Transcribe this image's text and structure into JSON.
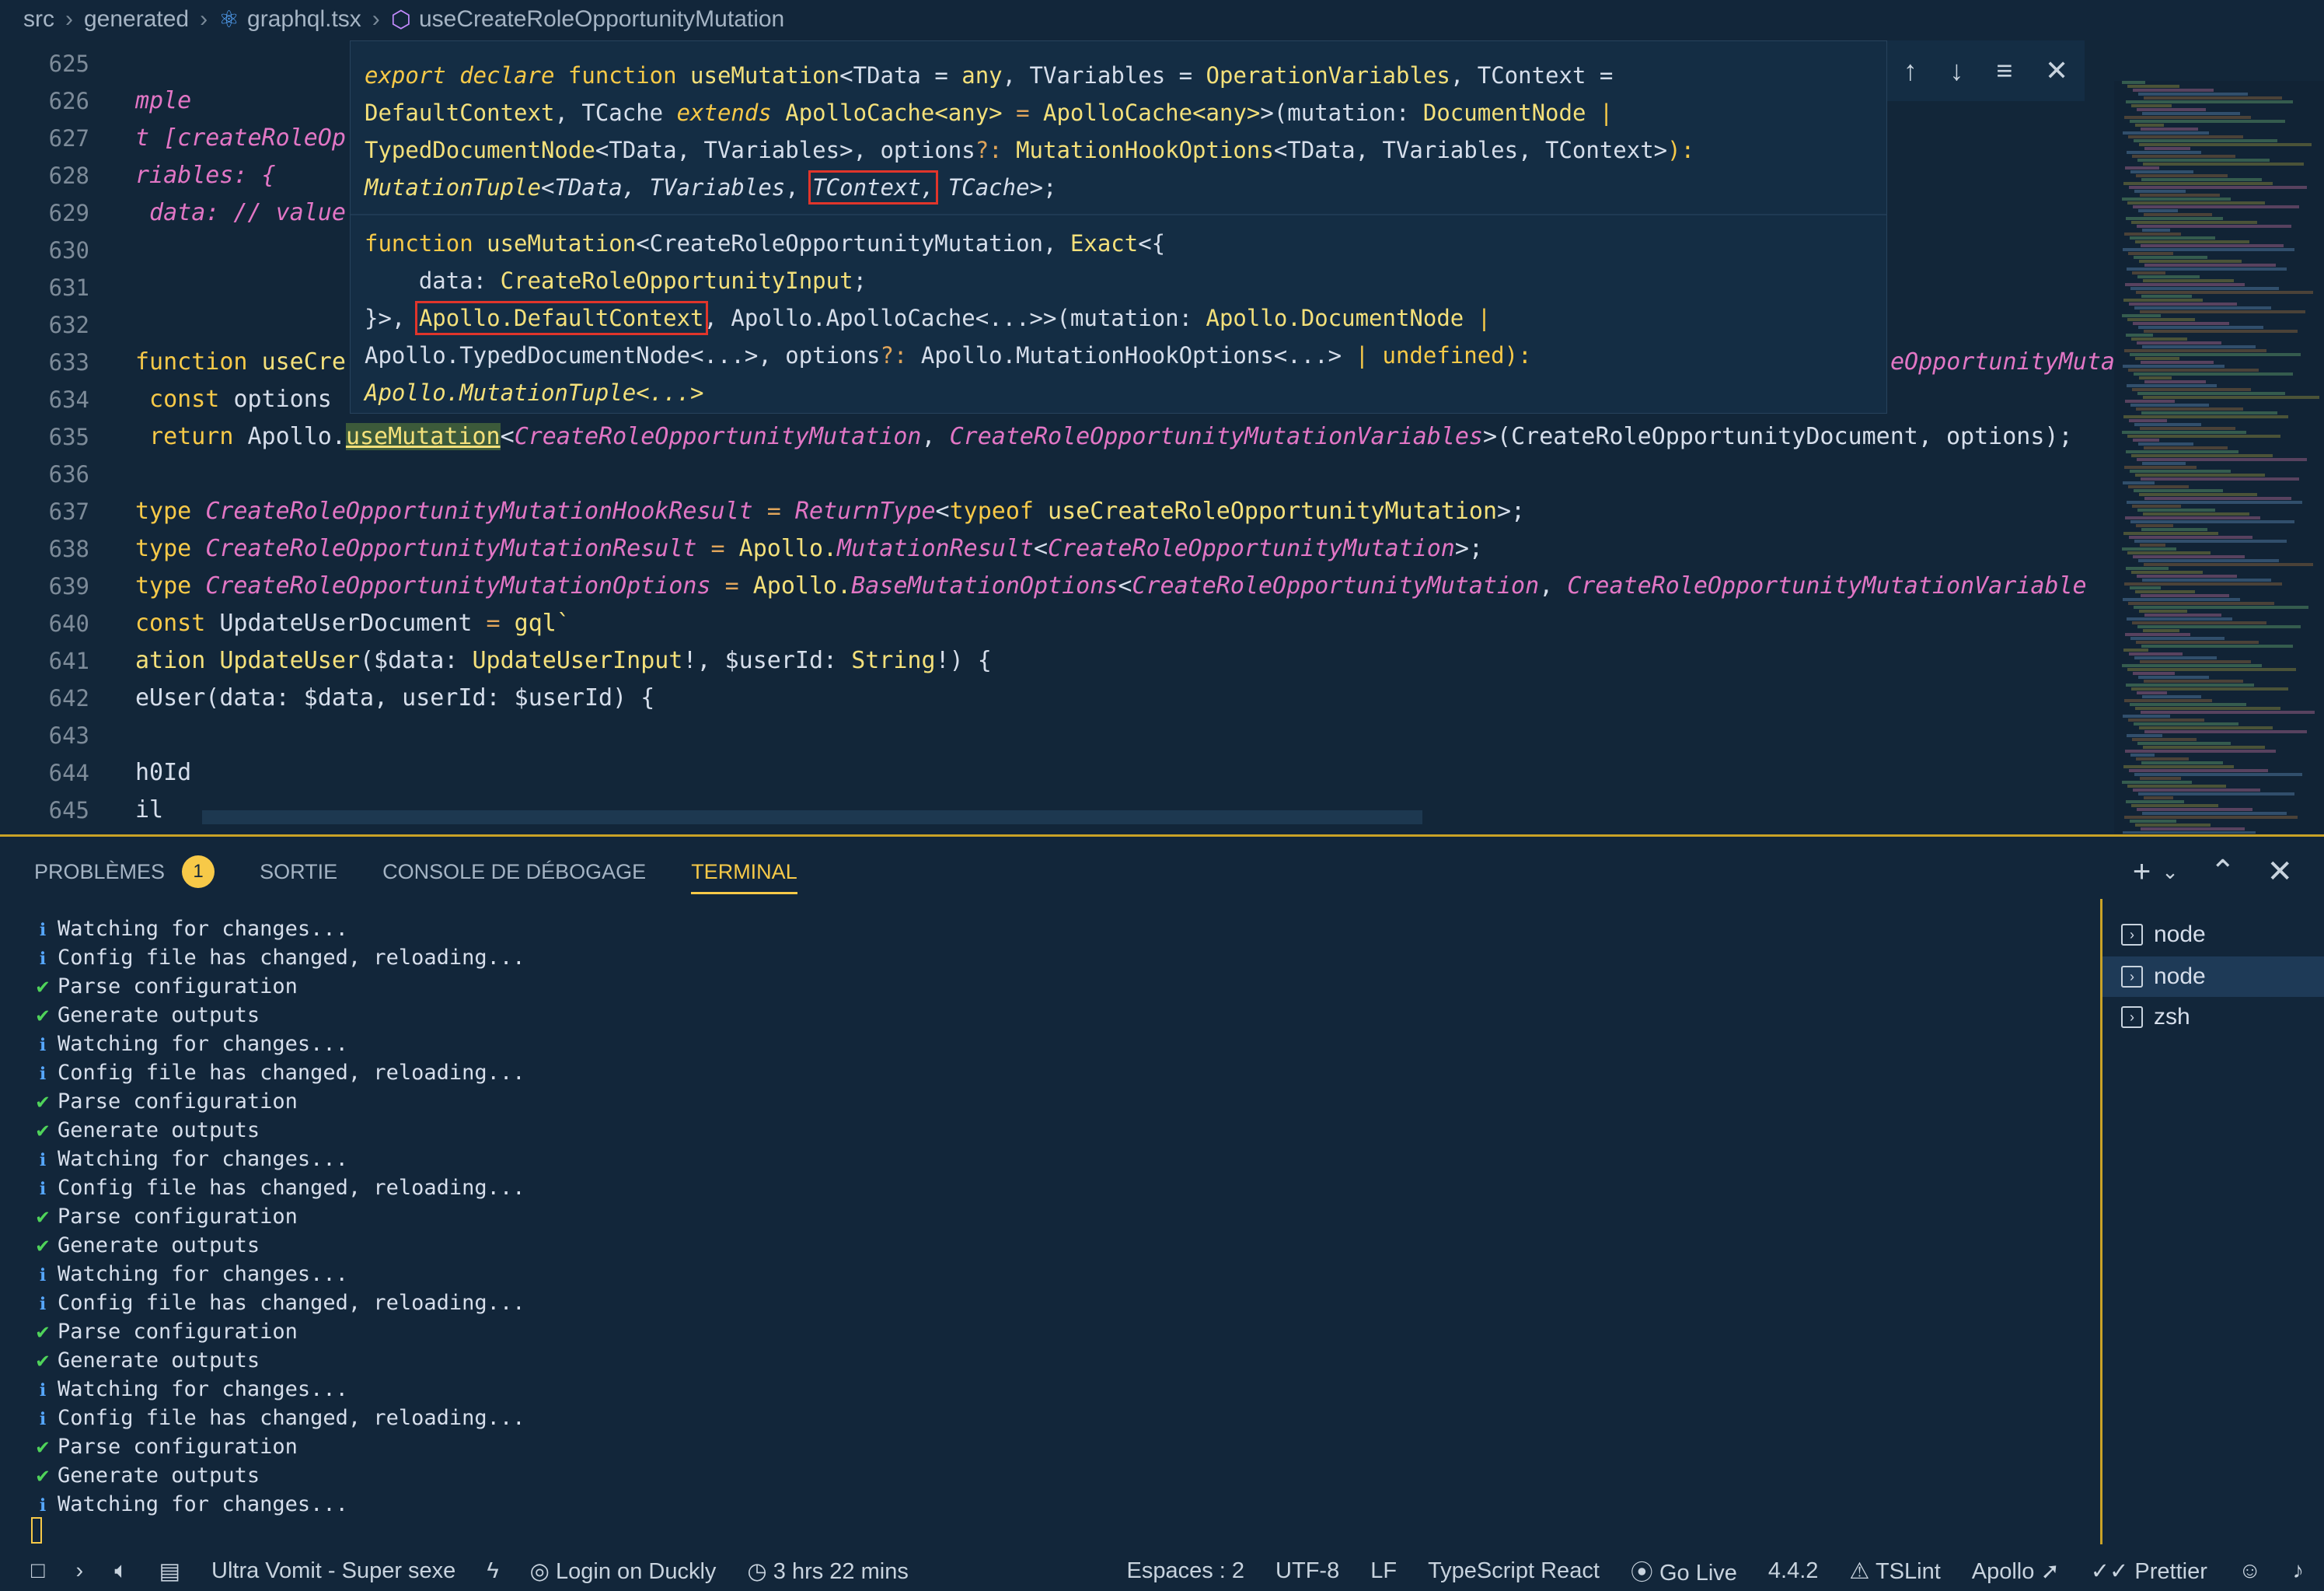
{
  "breadcrumb": {
    "items": [
      "src",
      "generated",
      "graphql.tsx",
      "useCreateRoleOpportunityMutation"
    ]
  },
  "editor": {
    "line_numbers": [
      "625",
      "626",
      "627",
      "628",
      "629",
      "630",
      "631",
      "632",
      "633",
      "634",
      "635",
      "636",
      "637",
      "638",
      "639",
      "640",
      "641",
      "642",
      "643",
      "644",
      "645"
    ],
    "lines": {
      "l626": "mple",
      "l627": "t [createRoleOp",
      "l628": "riables: {",
      "l629": " data: // value",
      "l633a": "function ",
      "l633b": "useCre",
      "l633c": "eOpportunityMutat",
      "l634a": " const ",
      "l634b": "options",
      "l635a": " return ",
      "l635b": "Apollo.",
      "l635c": "useMutation",
      "l635d": "<",
      "l635e": "CreateRoleOpportunityMutation",
      "l635f": ", ",
      "l635g": "CreateRoleOpportunityMutationVariables",
      "l635h": ">(CreateRoleOpportunityDocument, options);",
      "l637a": "type ",
      "l637b": "CreateRoleOpportunityMutationHookResult",
      "l637c": " = ",
      "l637d": "ReturnType",
      "l637e": "<",
      "l637f": "typeof ",
      "l637g": "useCreateRoleOpportunityMutation",
      "l637h": ">;",
      "l638a": "type ",
      "l638b": "CreateRoleOpportunityMutationResult",
      "l638c": " = ",
      "l638d": "Apollo.",
      "l638e": "MutationResult",
      "l638f": "<",
      "l638g": "CreateRoleOpportunityMutation",
      "l638h": ">;",
      "l639a": "type ",
      "l639b": "CreateRoleOpportunityMutationOptions",
      "l639c": " = ",
      "l639d": "Apollo.",
      "l639e": "BaseMutationOptions",
      "l639f": "<",
      "l639g": "CreateRoleOpportunityMutation",
      "l639h": ", ",
      "l639i": "CreateRoleOpportunityMutationVariable",
      "l640a": "const ",
      "l640b": "UpdateUserDocument",
      "l640c": " = ",
      "l640d": "gql`",
      "l641a": "ation ",
      "l641b": "UpdateUser",
      "l641c": "($data: ",
      "l641d": "UpdateUserInput",
      "l641e": "!, $userId: ",
      "l641f": "String",
      "l641g": "!) {",
      "l642": "eUser(data: $data, userId: $userId) {",
      "l644": "h0Id",
      "l645": "il"
    }
  },
  "hover": {
    "h1a": "export declare ",
    "h1b": "function ",
    "h1c": "useMutation",
    "h1d": "<TData = ",
    "h1e": "any",
    "h1f": ", TVariables = ",
    "h1g": "OperationVariables",
    "h1h": ", TContext =",
    "h2a": "DefaultContext",
    "h2b": ", TCache ",
    "h2c": "extends ",
    "h2d": "ApolloCache<any>",
    "h2e": " = ",
    "h2f": "ApolloCache<any>",
    "h2g": ">(mutation: ",
    "h2h": "DocumentNode",
    "h2i": " |",
    "h3a": "TypedDocumentNode",
    "h3b": "<TData, TVariables>, options",
    "h3c": "?: ",
    "h3d": "MutationHookOptions",
    "h3e": "<TData, TVariables, TContext>",
    "h3f": "):",
    "h4a": "MutationTuple",
    "h4b": "<TData, ",
    "h4c": "TVariables",
    "h4d": ", ",
    "h4e": "TContext,",
    "h4f": " TCache",
    "h4g": ">;",
    "s1a": "function ",
    "s1b": "useMutation",
    "s1c": "<CreateRoleOpportunityMutation, ",
    "s1d": "Exact",
    "s1e": "<{",
    "s2a": "    data: ",
    "s2b": "CreateRoleOpportunityInput",
    "s2c": ";",
    "s3a": "}>, ",
    "s3b": "Apollo.DefaultContext",
    "s3c": ", Apollo.ApolloCache<...>>(mutation: ",
    "s3d": "Apollo.DocumentNode",
    "s3e": " |",
    "s4a": "Apollo.TypedDocumentNode<...>, options",
    "s4b": "?: ",
    "s4c": "Apollo.MutationHookOptions<...>",
    "s4d": " | ",
    "s4e": "undefined",
    "s4f": "):",
    "s5": "Apollo.MutationTuple<...>"
  },
  "panel": {
    "tabs": [
      "PROBLÈMES",
      "SORTIE",
      "CONSOLE DE DÉBOGAGE",
      "TERMINAL"
    ],
    "problems_count": "1",
    "terminals": [
      "node",
      "node",
      "zsh"
    ]
  },
  "terminal": {
    "lines": [
      {
        "icon": "info",
        "text": "Watching for changes..."
      },
      {
        "icon": "info",
        "text": "Config file has changed, reloading..."
      },
      {
        "icon": "check",
        "text": "Parse configuration"
      },
      {
        "icon": "check",
        "text": "Generate outputs"
      },
      {
        "icon": "info",
        "text": "Watching for changes..."
      },
      {
        "icon": "info",
        "text": "Config file has changed, reloading..."
      },
      {
        "icon": "check",
        "text": "Parse configuration"
      },
      {
        "icon": "check",
        "text": "Generate outputs"
      },
      {
        "icon": "info",
        "text": "Watching for changes..."
      },
      {
        "icon": "info",
        "text": "Config file has changed, reloading..."
      },
      {
        "icon": "check",
        "text": "Parse configuration"
      },
      {
        "icon": "check",
        "text": "Generate outputs"
      },
      {
        "icon": "info",
        "text": "Watching for changes..."
      },
      {
        "icon": "info",
        "text": "Config file has changed, reloading..."
      },
      {
        "icon": "check",
        "text": "Parse configuration"
      },
      {
        "icon": "check",
        "text": "Generate outputs"
      },
      {
        "icon": "info",
        "text": "Watching for changes..."
      },
      {
        "icon": "info",
        "text": "Config file has changed, reloading..."
      },
      {
        "icon": "check",
        "text": "Parse configuration"
      },
      {
        "icon": "check",
        "text": "Generate outputs"
      },
      {
        "icon": "info",
        "text": "Watching for changes..."
      }
    ]
  },
  "status": {
    "music": "Ultra Vomit - Super sexe",
    "login": "Login on Duckly",
    "time": "3 hrs 22 mins",
    "spaces": "Espaces : 2",
    "encoding": "UTF-8",
    "eol": "LF",
    "language": "TypeScript React",
    "golive": "Go Live",
    "version": "4.4.2",
    "tslint": "TSLint",
    "apollo": "Apollo",
    "prettier": "Prettier"
  },
  "colors": {
    "accent": "#f7c948",
    "background": "#12263a",
    "annotation_box": "#e0352b"
  }
}
